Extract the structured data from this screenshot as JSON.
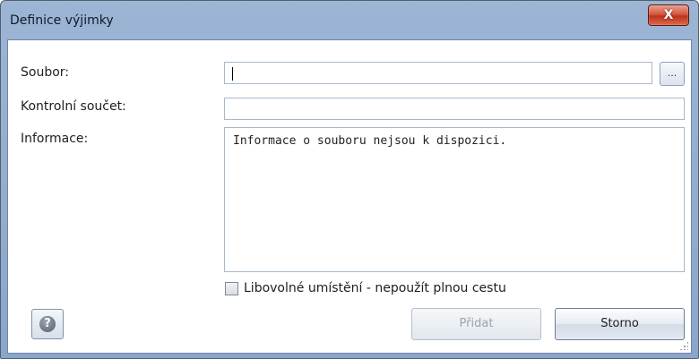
{
  "window": {
    "title": "Definice výjimky",
    "close_label": "X"
  },
  "form": {
    "file_label": "Soubor:",
    "file_value": "",
    "browse_label": "...",
    "checksum_label": "Kontrolní součet:",
    "checksum_value": "",
    "info_label": "Informace:",
    "info_text": "Informace o souboru nejsou k dispozici.",
    "any_location_label": "Libovolné umístění - nepoužít plnou cestu",
    "any_location_checked": false
  },
  "buttons": {
    "help_label": "?",
    "add_label": "Přidat",
    "add_enabled": false,
    "cancel_label": "Storno"
  },
  "colors": {
    "titlebar": "#9db5d4",
    "close_button": "#c0321c"
  }
}
